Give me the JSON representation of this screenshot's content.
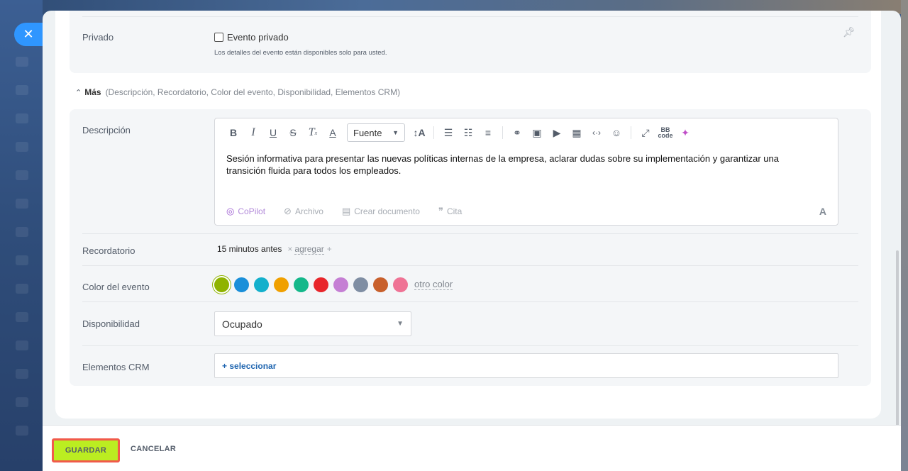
{
  "privado": {
    "label": "Privado",
    "checkbox_label": "Evento privado",
    "hint": "Los detalles del evento están disponibles solo para usted."
  },
  "more": {
    "label": "Más",
    "summary": "(Descripción, Recordatorio, Color del evento, Disponibilidad, Elementos CRM)"
  },
  "description": {
    "label": "Descripción",
    "text": "Sesión informativa para presentar las nuevas políticas internas de la empresa, aclarar dudas sobre su implementación y garantizar una transición fluida para todos los empleados.",
    "font_select": "Fuente",
    "footer": {
      "copilot": "CoPilot",
      "archivo": "Archivo",
      "crear_documento": "Crear documento",
      "cita": "Cita"
    }
  },
  "reminder": {
    "label": "Recordatorio",
    "value": "15 minutos antes",
    "add": "agregar"
  },
  "event_color": {
    "label": "Color del evento",
    "colors": [
      "#8fb300",
      "#1a8fd9",
      "#14b0cc",
      "#f0a000",
      "#14b88a",
      "#e8262b",
      "#c57fd4",
      "#7f8ea3",
      "#c8602c",
      "#ef7395"
    ],
    "selected_index": 0,
    "other": "otro color"
  },
  "availability": {
    "label": "Disponibilidad",
    "value": "Ocupado"
  },
  "crm": {
    "label": "Elementos CRM",
    "select": "+ seleccionar"
  },
  "footer": {
    "save": "GUARDAR",
    "cancel": "CANCELAR"
  }
}
